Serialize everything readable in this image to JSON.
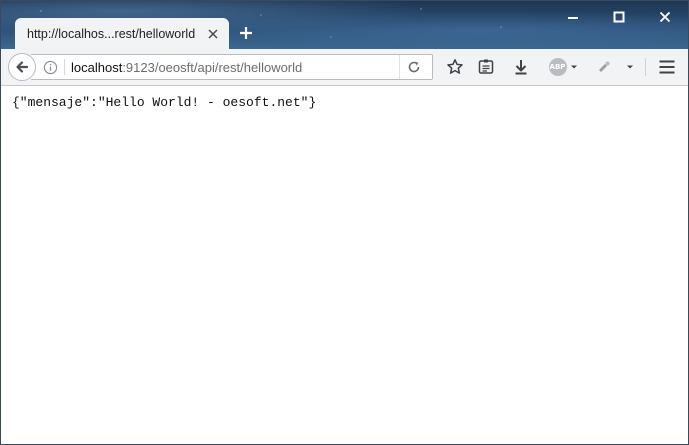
{
  "browser": {
    "tab": {
      "title": "http://localhos...rest/helloworld",
      "close_icon": "close-icon"
    },
    "new_tab_icon": "plus-icon",
    "window_controls": [
      "minimize-icon",
      "maximize-icon",
      "close-icon"
    ],
    "address_bar": {
      "host": "localhost",
      "path": ":9123/oeosft/api/rest/helloworld"
    },
    "toolbar_icons": [
      "star-icon",
      "reader-list-icon",
      "download-icon",
      "adblock-icon",
      "extension-icon",
      "menu-icon"
    ],
    "adblock_label": "ABP"
  },
  "page": {
    "body_text": "{\"mensaje\":\"Hello World! - oesoft.net\"}"
  },
  "colors": {
    "chrome": "#f2f3f5",
    "titlebar": "#2d5178",
    "url_path": "#6d6d6d"
  }
}
